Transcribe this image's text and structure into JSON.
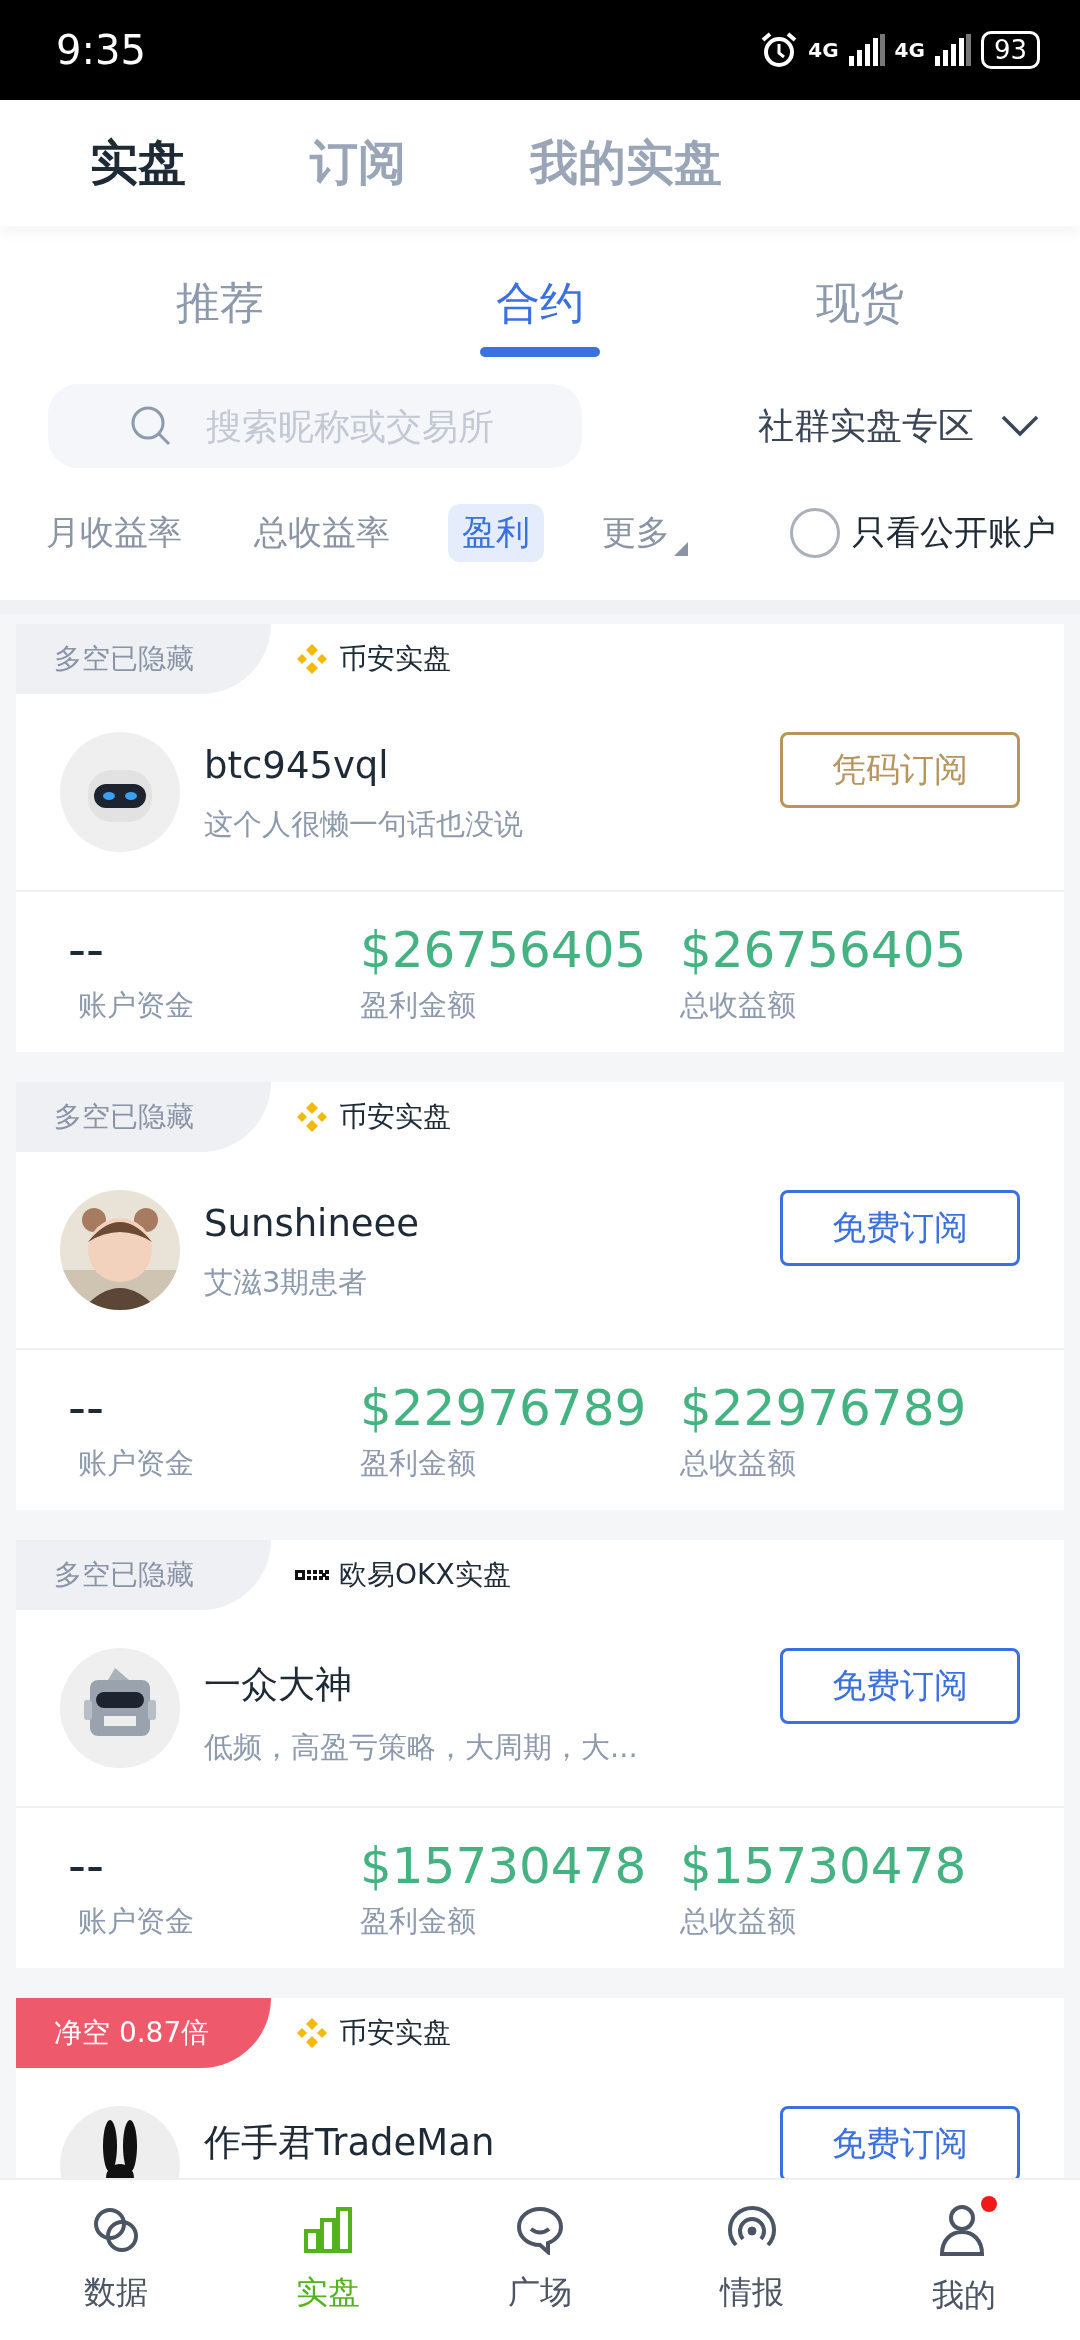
{
  "status_bar": {
    "time": "9:35",
    "battery": "93",
    "network_1": "4G",
    "network_2": "4G"
  },
  "top_tabs": [
    {
      "label": "实盘",
      "selected": true
    },
    {
      "label": "订阅",
      "selected": false
    },
    {
      "label": "我的实盘",
      "selected": false
    }
  ],
  "sub_tabs": [
    {
      "label": "推荐",
      "selected": false
    },
    {
      "label": "合约",
      "selected": true
    },
    {
      "label": "现货",
      "selected": false
    }
  ],
  "search": {
    "placeholder": "搜索昵称或交易所"
  },
  "zone_dropdown": {
    "label": "社群实盘专区"
  },
  "filters": [
    {
      "label": "月收益率",
      "selected": false,
      "kind": "plain"
    },
    {
      "label": "总收益率",
      "selected": false,
      "kind": "plain"
    },
    {
      "label": "盈利",
      "selected": true,
      "kind": "plain"
    },
    {
      "label": "更多",
      "selected": false,
      "kind": "menu"
    }
  ],
  "public_only": {
    "label": "只看公开账户",
    "checked": false
  },
  "cards": [
    {
      "tag": {
        "kind": "hidden",
        "text": "多空已隐藏"
      },
      "exchange": {
        "kind": "binance",
        "name": "币安实盘"
      },
      "avatar": {
        "kind": "robot_white"
      },
      "name": "btc945vql",
      "bio": "这个人很懒一句话也没说",
      "button": {
        "kind": "code",
        "label": "凭码订阅"
      },
      "stats": [
        {
          "value": "--",
          "label": "账户资金",
          "kind": "empty"
        },
        {
          "value": "$26756405",
          "label": "盈利金额",
          "kind": "money"
        },
        {
          "value": "$26756405",
          "label": "总收益额",
          "kind": "money"
        }
      ]
    },
    {
      "tag": {
        "kind": "hidden",
        "text": "多空已隐藏"
      },
      "exchange": {
        "kind": "binance",
        "name": "币安实盘"
      },
      "avatar": {
        "kind": "picture"
      },
      "name": "Sunshineee",
      "bio": "艾滋3期患者",
      "button": {
        "kind": "free",
        "label": "免费订阅"
      },
      "stats": [
        {
          "value": "--",
          "label": "账户资金",
          "kind": "empty"
        },
        {
          "value": "$22976789",
          "label": "盈利金额",
          "kind": "money"
        },
        {
          "value": "$22976789",
          "label": "总收益额",
          "kind": "money"
        }
      ]
    },
    {
      "tag": {
        "kind": "hidden",
        "text": "多空已隐藏"
      },
      "exchange": {
        "kind": "okx",
        "name": "欧易OKX实盘"
      },
      "avatar": {
        "kind": "robot_grey"
      },
      "name": "一众大神",
      "bio": "低频，高盈亏策略，大周期，大...",
      "button": {
        "kind": "free",
        "label": "免费订阅"
      },
      "stats": [
        {
          "value": "--",
          "label": "账户资金",
          "kind": "empty"
        },
        {
          "value": "$15730478",
          "label": "盈利金额",
          "kind": "money"
        },
        {
          "value": "$15730478",
          "label": "总收益额",
          "kind": "money"
        }
      ]
    },
    {
      "tag": {
        "kind": "net_short",
        "text": "净空 0.87倍"
      },
      "exchange": {
        "kind": "binance",
        "name": "币安实盘"
      },
      "avatar": {
        "kind": "rabbit"
      },
      "name": "作手君TradeMan",
      "button": {
        "kind": "free",
        "label": "免费订阅"
      }
    }
  ],
  "bottom_nav": [
    {
      "label": "数据",
      "kind": "circles",
      "selected": false,
      "badge": false
    },
    {
      "label": "实盘",
      "kind": "bars",
      "selected": true,
      "badge": false
    },
    {
      "label": "广场",
      "kind": "chat",
      "selected": false,
      "badge": false
    },
    {
      "label": "情报",
      "kind": "signal",
      "selected": false,
      "badge": false
    },
    {
      "label": "我的",
      "kind": "person",
      "selected": false,
      "badge": true
    }
  ]
}
